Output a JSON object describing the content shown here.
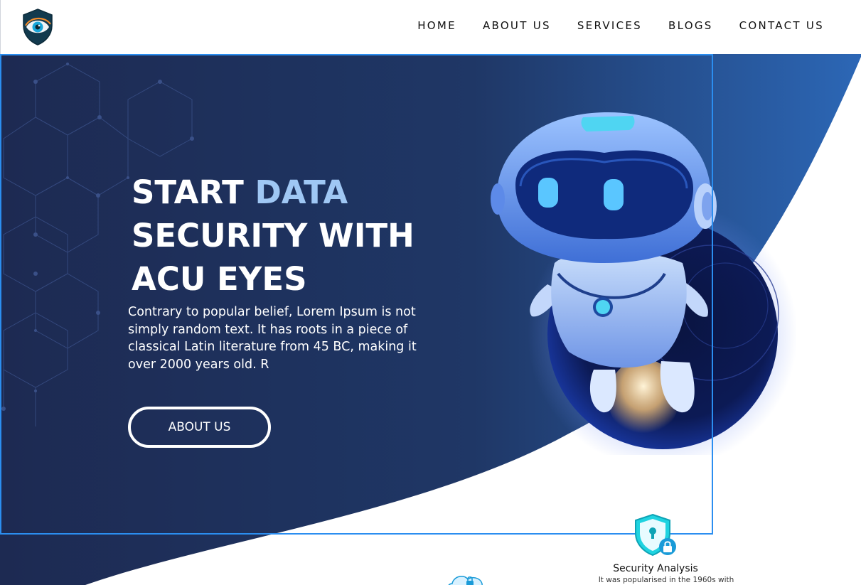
{
  "header": {
    "logo_icon": "eye-shield-logo",
    "nav": [
      {
        "label": "HOME"
      },
      {
        "label": "ABOUT US"
      },
      {
        "label": "SERVICES"
      },
      {
        "label": "BLOGS"
      },
      {
        "label": "CONTACT US"
      }
    ]
  },
  "hero": {
    "title_start": "START ",
    "title_accent": "DATA",
    "title_line2": "SECURITY WITH",
    "title_line3": "ACU EYES",
    "text": "Contrary to popular belief, Lorem Ipsum is not simply random text. It has roots in a piece of classical Latin literature from 45 BC, making it over 2000 years old. R",
    "button_label": "ABOUT US",
    "illustration": "robot-illustration"
  },
  "services": [
    {
      "icon": "shield-lock-icon",
      "title": "Security Analysis",
      "text": "It was popularised in the 1960s with"
    },
    {
      "icon": "cloud-lock-icon"
    }
  ],
  "colors": {
    "hero_dark": "#1c2a52",
    "hero_accent_blue": "#2c67b6",
    "title_accent": "#9fc7f4",
    "frame_border": "#2b8ef0",
    "icon_cyan": "#1fd3e0"
  }
}
